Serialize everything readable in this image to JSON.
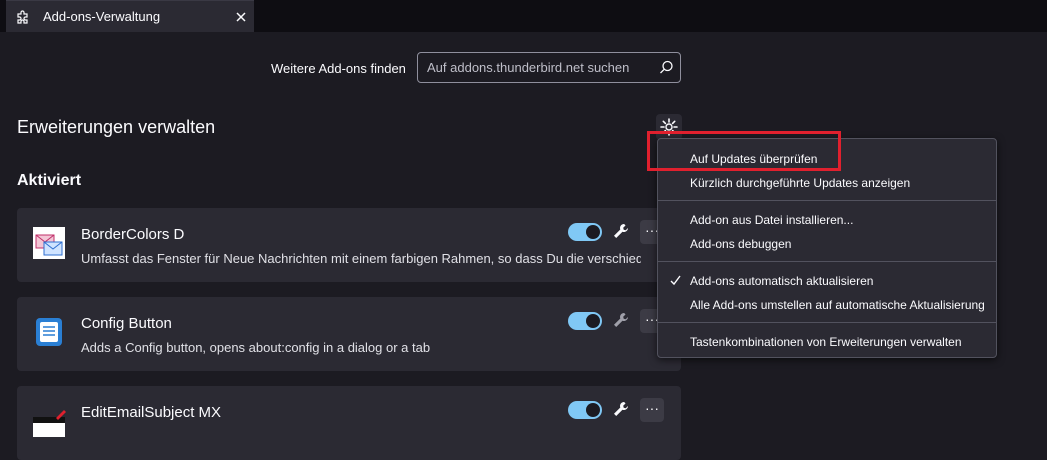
{
  "tab": {
    "title": "Add-ons-Verwaltung"
  },
  "search": {
    "label": "Weitere Add-ons finden",
    "placeholder": "Auf addons.thunderbird.net suchen",
    "value": ""
  },
  "page": {
    "title": "Erweiterungen verwalten",
    "section": "Aktiviert"
  },
  "addons": [
    {
      "name": "BorderColors D",
      "description": "Umfasst das Fenster für Neue Nachrichten mit einem farbigen Rahmen, so dass Du die verschiede...",
      "enabled": true
    },
    {
      "name": "Config Button",
      "description": "Adds a Config button, opens about:config in a dialog or a tab",
      "enabled": true
    },
    {
      "name": "EditEmailSubject MX",
      "description": "",
      "enabled": true
    }
  ],
  "addon_more_label": "···",
  "menu": {
    "items": [
      {
        "label": "Auf Updates überprüfen",
        "checked": false
      },
      {
        "label": "Kürzlich durchgeführte Updates anzeigen",
        "checked": false
      },
      {
        "label": "Add-on aus Datei installieren...",
        "checked": false
      },
      {
        "label": "Add-ons debuggen",
        "checked": false
      },
      {
        "label": "Add-ons automatisch aktualisieren",
        "checked": true
      },
      {
        "label": "Alle Add-ons umstellen auf automatische Aktualisierung",
        "checked": false
      },
      {
        "label": "Tastenkombinationen von Erweiterungen verwalten",
        "checked": false
      }
    ]
  },
  "colors": {
    "accent": "#80c8f5",
    "highlight": "#e0202e",
    "background": "#1c1b22",
    "card": "#2b2a33"
  },
  "icons": [
    "puzzle-icon",
    "close-icon",
    "search-icon",
    "gear-icon",
    "wrench-icon",
    "check-icon"
  ]
}
